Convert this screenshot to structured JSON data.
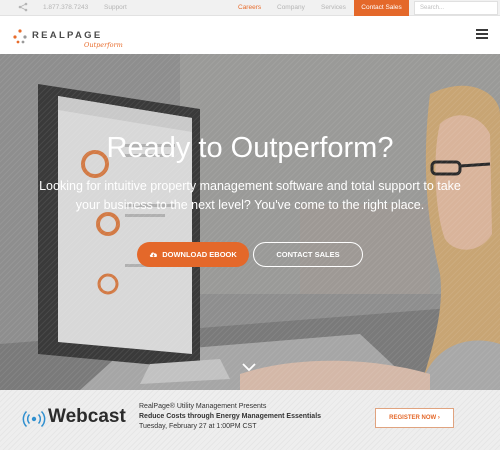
{
  "topbar": {
    "phone": "1.877.378.7243",
    "support": "Support",
    "careers": "Careers",
    "company": "Company",
    "services": "Services",
    "contact_sales": "Contact Sales",
    "search_placeholder": "Search..."
  },
  "header": {
    "logo_word": "REALPAGE",
    "logo_tag": "Outperform"
  },
  "hero": {
    "headline": "Ready to Outperform?",
    "subhead": "Looking for intuitive property management software and total support to take your business to the next level? You've come to the right place.",
    "download_label": "DOWNLOAD EBOOK",
    "contact_label": "CONTACT SALES"
  },
  "banner": {
    "title": "Webcast",
    "line1": "RealPage® Utility Management Presents",
    "line2": "Reduce Costs through Energy Management Essentials",
    "line3": "Tuesday, February 27 at 1:00PM CST",
    "register_label": "REGISTER NOW ›"
  },
  "colors": {
    "accent": "#e4682a",
    "topbar_bg": "#f1f1f1",
    "text_dark": "#2b2b2b"
  },
  "icons": [
    "share-icon",
    "hamburger-menu-icon",
    "cloud-download-icon",
    "chevron-down-icon",
    "webcast-signal-icon"
  ]
}
